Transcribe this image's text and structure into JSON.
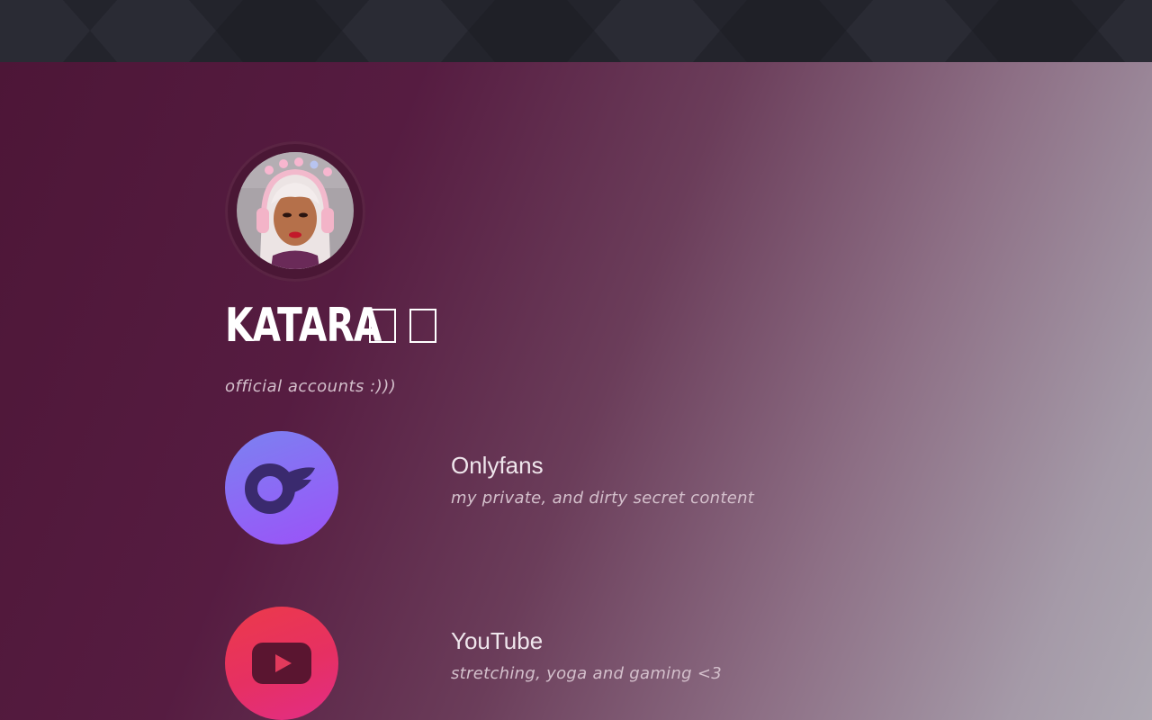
{
  "profile": {
    "name": "KATARA",
    "tagline": "official accounts :)))",
    "name_glyphs": [
      "missing-glyph-box",
      "missing-glyph-box"
    ]
  },
  "links": [
    {
      "title": "Onlyfans",
      "description": "my private, and dirty secret content",
      "icon": "onlyfans-logo-icon",
      "gradient": [
        "#7b82f0",
        "#9b52f7"
      ]
    },
    {
      "title": "YouTube",
      "description": "stretching, yoga and gaming <3",
      "icon": "youtube-logo-icon",
      "gradient": [
        "#ec3a4a",
        "#e22d86"
      ]
    }
  ],
  "colors": {
    "topbar": "#23242c",
    "background_start": "#4d1637",
    "background_end": "#aea9b3",
    "text": "#ffffff",
    "muted_text": "#d4c0cc"
  }
}
